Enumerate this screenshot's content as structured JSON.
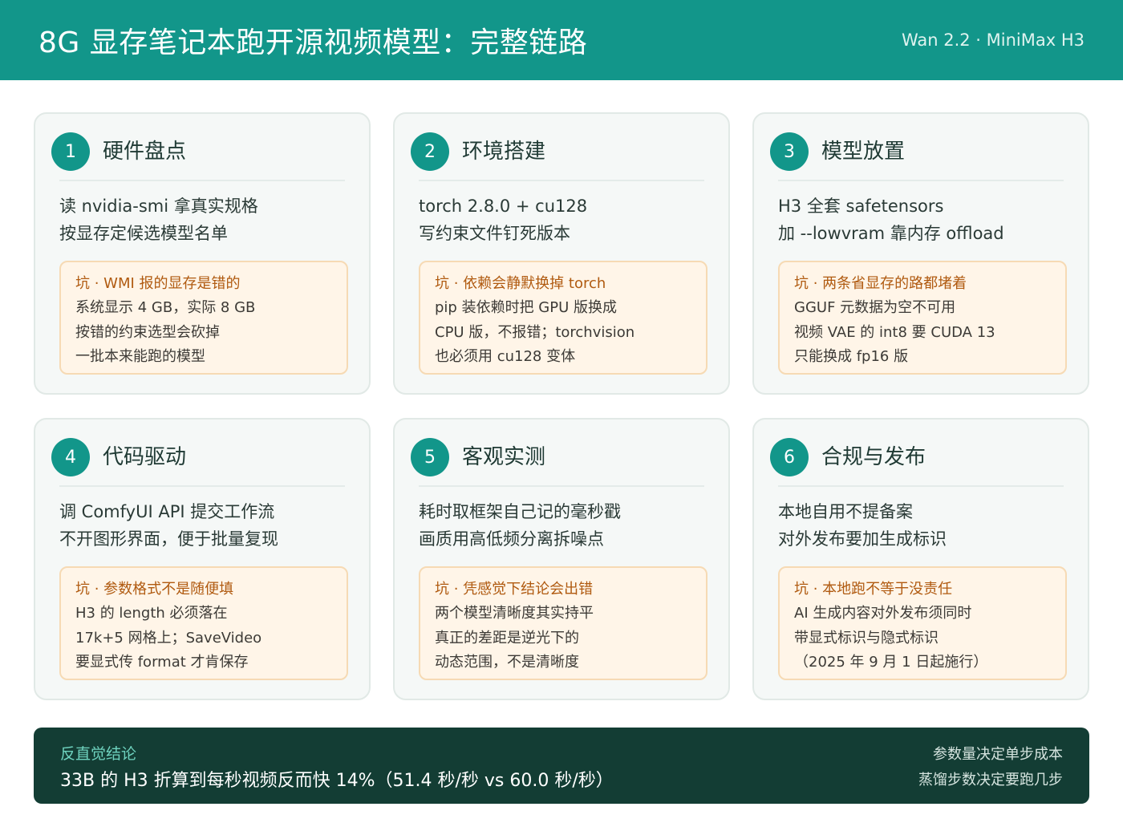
{
  "header": {
    "title": "8G 显存笔记本跑开源视频模型：完整链路",
    "subtitle": "Wan 2.2 · MiniMax H3"
  },
  "cards": [
    {
      "num": "1",
      "title": "硬件盘点",
      "desc": [
        "读 nvidia-smi 拿真实规格",
        "按显存定候选模型名单"
      ],
      "pit_title": "坑 · WMI 报的显存是错的",
      "pit_lines": [
        "系统显示 4 GB，实际 8 GB",
        "按错的约束选型会砍掉",
        "一批本来能跑的模型"
      ]
    },
    {
      "num": "2",
      "title": "环境搭建",
      "desc": [
        "torch 2.8.0 + cu128",
        "写约束文件钉死版本"
      ],
      "pit_title": "坑 · 依赖会静默换掉 torch",
      "pit_lines": [
        "pip 装依赖时把 GPU 版换成",
        "CPU 版，不报错；torchvision",
        "也必须用 cu128 变体"
      ]
    },
    {
      "num": "3",
      "title": "模型放置",
      "desc": [
        "H3 全套 safetensors",
        "加 --lowvram 靠内存 offload"
      ],
      "pit_title": "坑 · 两条省显存的路都堵着",
      "pit_lines": [
        "GGUF 元数据为空不可用",
        "视频 VAE 的 int8 要 CUDA 13",
        "只能换成 fp16 版"
      ]
    },
    {
      "num": "4",
      "title": "代码驱动",
      "desc": [
        "调 ComfyUI API 提交工作流",
        "不开图形界面，便于批量复现"
      ],
      "pit_title": "坑 · 参数格式不是随便填",
      "pit_lines": [
        "H3 的 length 必须落在",
        "17k+5 网格上；SaveVideo",
        "要显式传 format 才肯保存"
      ]
    },
    {
      "num": "5",
      "title": "客观实测",
      "desc": [
        "耗时取框架自己记的毫秒戳",
        "画质用高低频分离拆噪点"
      ],
      "pit_title": "坑 · 凭感觉下结论会出错",
      "pit_lines": [
        "两个模型清晰度其实持平",
        "真正的差距是逆光下的",
        "动态范围，不是清晰度"
      ]
    },
    {
      "num": "6",
      "title": "合规与发布",
      "desc": [
        "本地自用不提备案",
        "对外发布要加生成标识"
      ],
      "pit_title": "坑 · 本地跑不等于没责任",
      "pit_lines": [
        "AI 生成内容对外发布须同时",
        "带显式标识与隐式标识",
        "（2025 年 9 月 1 日起施行）"
      ]
    }
  ],
  "footer": {
    "label": "反直觉结论",
    "text": "33B 的 H3 折算到每秒视频反而快 14%（51.4 秒/秒 vs 60.0 秒/秒）",
    "right_lines": [
      "参数量决定单步成本",
      "蒸馏步数决定要跑几步"
    ]
  }
}
